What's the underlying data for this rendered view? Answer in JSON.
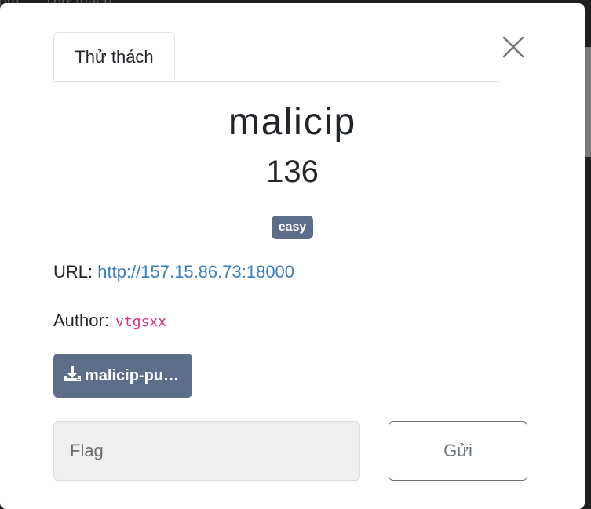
{
  "background": {
    "breadcrumb_left": "om",
    "breadcrumb_right": "Thử thách"
  },
  "modal": {
    "tab_label": "Thử thách",
    "challenge_name": "malicip",
    "points": "136",
    "difficulty": "easy",
    "url_label": "URL:",
    "url_value": "http://157.15.86.73:18000",
    "author_label": "Author:",
    "author_value": "vtgsxx",
    "download_label": "malicip-pu…",
    "flag_placeholder": "Flag",
    "flag_value": "",
    "submit_label": "Gửi"
  },
  "colors": {
    "badge": "#5c6e8a",
    "link": "#3a7ec3",
    "author_code": "#d63384"
  },
  "icons": {
    "close": "close-icon",
    "download": "download-icon"
  }
}
